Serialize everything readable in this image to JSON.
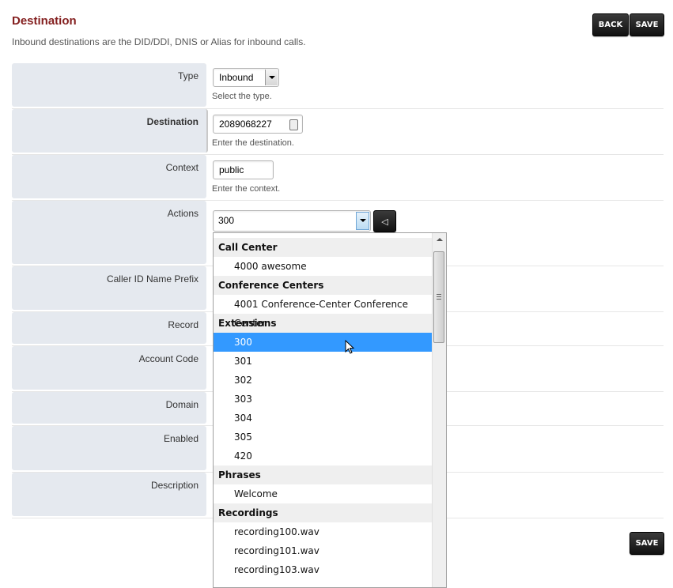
{
  "page": {
    "title": "Destination",
    "subtitle": "Inbound destinations are the DID/DDI, DNIS or Alias for inbound calls.",
    "back_label": "BACK",
    "save_label": "SAVE",
    "save_bottom_label": "SAVE"
  },
  "form": {
    "type": {
      "label": "Type",
      "value": "Inbound",
      "hint": "Select the type."
    },
    "destination": {
      "label": "Destination",
      "value": "2089068227",
      "hint": "Enter the destination."
    },
    "context": {
      "label": "Context",
      "value": "public",
      "hint": "Enter the context."
    },
    "actions": {
      "label": "Actions",
      "value": "300"
    },
    "caller_id_name_prefix": {
      "label": "Caller ID Name Prefix"
    },
    "record": {
      "label": "Record"
    },
    "account_code": {
      "label": "Account Code"
    },
    "domain": {
      "label": "Domain"
    },
    "enabled": {
      "label": "Enabled"
    },
    "description": {
      "label": "Description"
    }
  },
  "dropdown": {
    "options": [
      {
        "kind": "group",
        "text": "Call Center"
      },
      {
        "kind": "item",
        "text": "4000 awesome"
      },
      {
        "kind": "group",
        "text": "Conference Centers"
      },
      {
        "kind": "item",
        "text": "4001 Conference-Center Conference Center"
      },
      {
        "kind": "group",
        "text": "Extensions"
      },
      {
        "kind": "item",
        "text": "300",
        "selected": true
      },
      {
        "kind": "item",
        "text": "301"
      },
      {
        "kind": "item",
        "text": "302"
      },
      {
        "kind": "item",
        "text": "303"
      },
      {
        "kind": "item",
        "text": "304"
      },
      {
        "kind": "item",
        "text": "305"
      },
      {
        "kind": "item",
        "text": "420"
      },
      {
        "kind": "group",
        "text": "Phrases"
      },
      {
        "kind": "item",
        "text": "Welcome"
      },
      {
        "kind": "group",
        "text": "Recordings"
      },
      {
        "kind": "item",
        "text": "recording100.wav"
      },
      {
        "kind": "item",
        "text": "recording101.wav"
      },
      {
        "kind": "item",
        "text": "recording103.wav"
      }
    ]
  },
  "colors": {
    "title": "#842020",
    "label_bg": "#e5e9ef",
    "highlight": "#3399ff"
  }
}
